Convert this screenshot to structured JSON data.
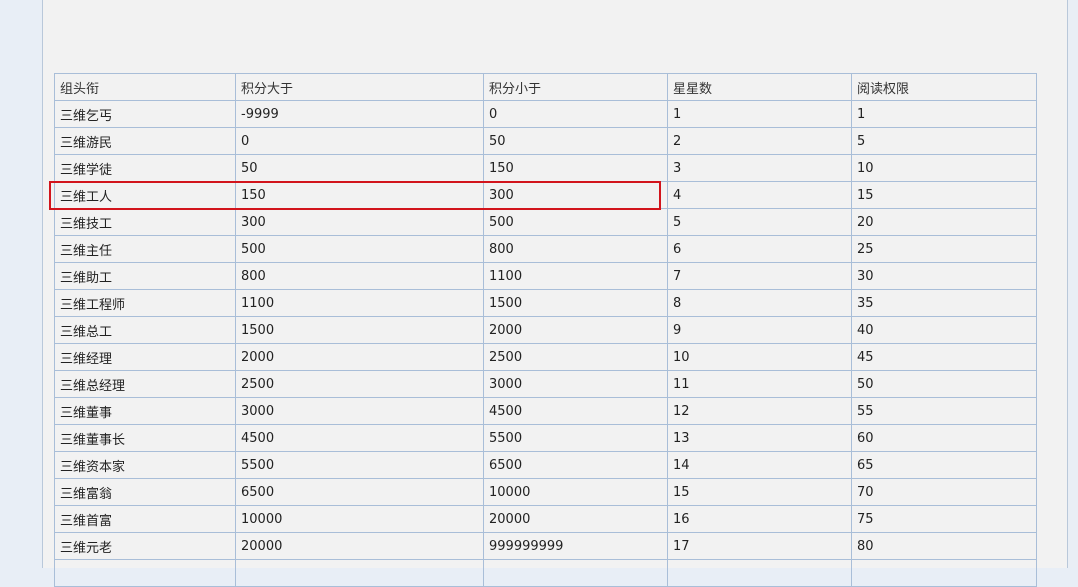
{
  "table": {
    "headers": [
      "组头衔",
      "积分大于",
      "积分小于",
      "星星数",
      "阅读权限"
    ],
    "rows": [
      [
        "三维乞丐",
        "-9999",
        "0",
        "1",
        "1"
      ],
      [
        "三维游民",
        "0",
        "50",
        "2",
        "5"
      ],
      [
        "三维学徒",
        "50",
        "150",
        "3",
        "10"
      ],
      [
        "三维工人",
        "150",
        "300",
        "4",
        "15"
      ],
      [
        "三维技工",
        "300",
        "500",
        "5",
        "20"
      ],
      [
        "三维主任",
        "500",
        "800",
        "6",
        "25"
      ],
      [
        "三维助工",
        "800",
        "1100",
        "7",
        "30"
      ],
      [
        "三维工程师",
        "1100",
        "1500",
        "8",
        "35"
      ],
      [
        "三维总工",
        "1500",
        "2000",
        "9",
        "40"
      ],
      [
        "三维经理",
        "2000",
        "2500",
        "10",
        "45"
      ],
      [
        "三维总经理",
        "2500",
        "3000",
        "11",
        "50"
      ],
      [
        "三维董事",
        "3000",
        "4500",
        "12",
        "55"
      ],
      [
        "三维董事长",
        "4500",
        "5500",
        "13",
        "60"
      ],
      [
        "三维资本家",
        "5500",
        "6500",
        "14",
        "65"
      ],
      [
        "三维富翁",
        "6500",
        "10000",
        "15",
        "70"
      ],
      [
        "三维首富",
        "10000",
        "20000",
        "16",
        "75"
      ],
      [
        "三维元老",
        "20000",
        "999999999",
        "17",
        "80"
      ]
    ]
  },
  "highlight": {
    "color": "#d2141c",
    "row": "三维工人"
  },
  "colors": {
    "border": "#a9bed8",
    "panel_bg": "#f2f2f2",
    "page_bg": "#e8eef6"
  }
}
